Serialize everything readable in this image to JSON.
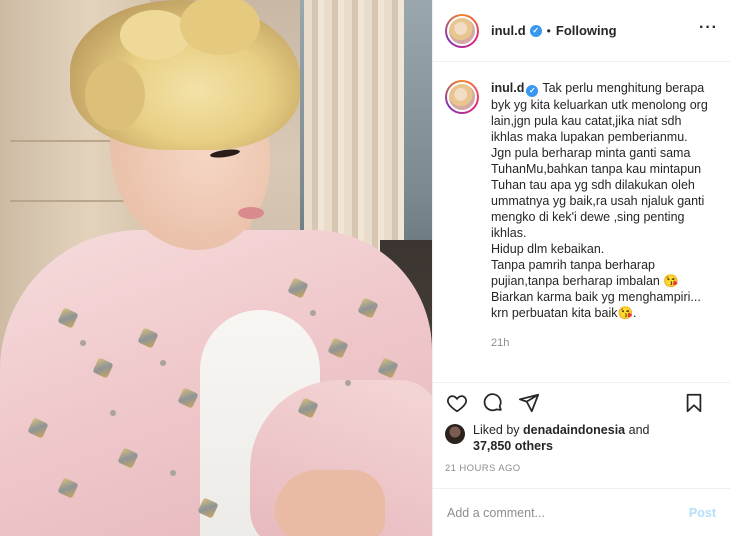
{
  "header": {
    "username": "inul.d",
    "verified_icon": "verified-badge-icon",
    "separator": "•",
    "follow_status": "Following",
    "more_icon": "more-options-icon"
  },
  "caption": {
    "username": "inul.d",
    "text": "Tak perlu menghitung berapa byk yg kita keluarkan utk menolong org lain,jgn pula kau catat,jika niat sdh ikhlas maka lupakan pemberianmu.\nJgn pula berharap minta ganti sama TuhanMu,bahkan tanpa kau mintapun Tuhan tau apa yg sdh dilakukan oleh ummatnya yg baik,ra usah njaluk ganti mengko di kek'i dewe ,sing penting ikhlas.\nHidup dlm kebaikan.\nTanpa pamrih tanpa berharap pujian,tanpa berharap imbalan 😘\nBiarkan karma baik yg menghampiri...\nkrn perbuatan kita baik😘.",
    "timestamp": "21h"
  },
  "actions": {
    "like_icon": "heart-icon",
    "comment_icon": "comment-icon",
    "share_icon": "share-icon",
    "save_icon": "bookmark-icon"
  },
  "likes": {
    "prefix": "Liked by ",
    "user": "denadaindonesia",
    "middle": " and",
    "count": "37,850 others"
  },
  "time_ago": "21 HOURS AGO",
  "add_comment": {
    "placeholder": "Add a comment...",
    "post_label": "Post",
    "post_color": "#b2dffc"
  },
  "colors": {
    "verified": "#3897f0",
    "text": "#262626",
    "muted": "#8e8e8e"
  }
}
